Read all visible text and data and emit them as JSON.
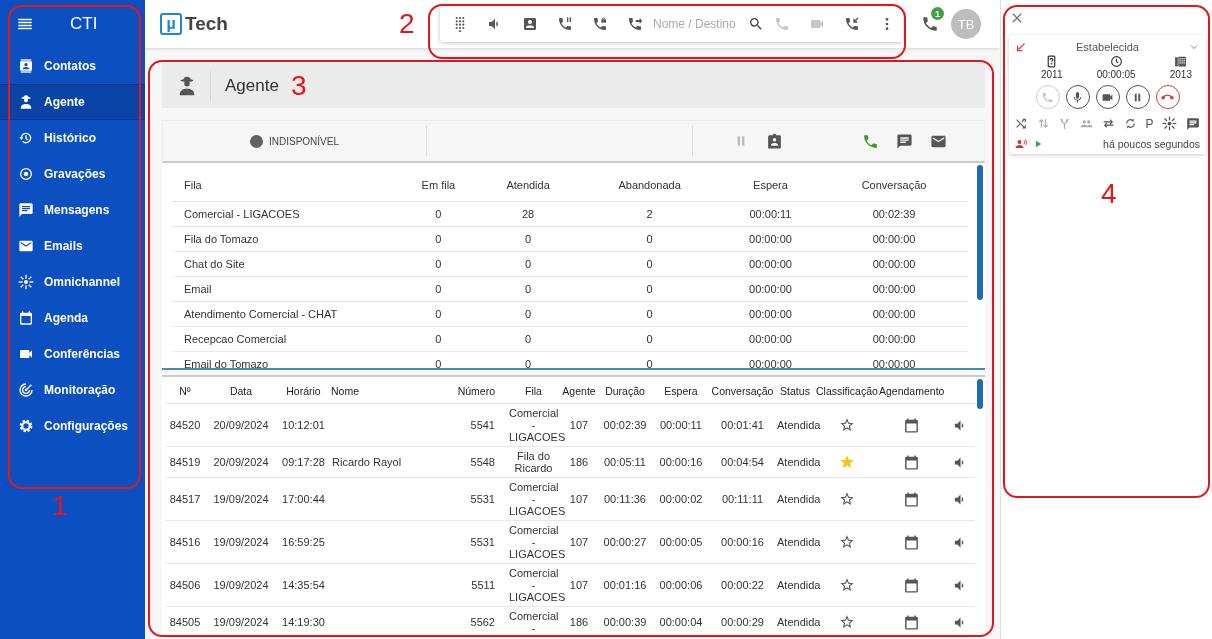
{
  "sidebar": {
    "title": "CTI",
    "items": [
      {
        "label": "Contatos",
        "selected": false
      },
      {
        "label": "Agente",
        "selected": true
      },
      {
        "label": "Histórico",
        "selected": false
      },
      {
        "label": "Gravações",
        "selected": false
      },
      {
        "label": "Mensagens",
        "selected": false
      },
      {
        "label": "Emails",
        "selected": false
      },
      {
        "label": "Omnichannel",
        "selected": false
      },
      {
        "label": "Agenda",
        "selected": false
      },
      {
        "label": "Conferências",
        "selected": false
      },
      {
        "label": "Monitoração",
        "selected": false
      },
      {
        "label": "Configurações",
        "selected": false
      }
    ]
  },
  "header": {
    "logo_mark": "µ",
    "logo_text": "Tech",
    "search": {
      "placeholder": "Nome / Destino"
    },
    "call_buttons": [
      {
        "disabled": true
      },
      {
        "disabled": true
      },
      {
        "disabled": false
      }
    ],
    "notification_badge": "1",
    "avatar": "TB"
  },
  "page": {
    "title": "Agente",
    "status": {
      "label": "INDISPONÍVEL",
      "pause_disabled": true
    }
  },
  "queue_table": {
    "columns": [
      "Fila",
      "Em fila",
      "Atendida",
      "Abandonada",
      "Espera",
      "Conversação"
    ],
    "rows": [
      [
        "Comercial - LIGACOES",
        "0",
        "28",
        "2",
        "00:00:11",
        "00:02:39"
      ],
      [
        "Fila do Tomazo",
        "0",
        "0",
        "0",
        "00:00:00",
        "00:00:00"
      ],
      [
        "Chat do Site",
        "0",
        "0",
        "0",
        "00:00:00",
        "00:00:00"
      ],
      [
        "Email",
        "0",
        "0",
        "0",
        "00:00:00",
        "00:00:00"
      ],
      [
        "Atendimento Comercial - CHAT",
        "0",
        "0",
        "0",
        "00:00:00",
        "00:00:00"
      ],
      [
        "Recepcao Comercial",
        "0",
        "0",
        "0",
        "00:00:00",
        "00:00:00"
      ],
      [
        "Email do Tomazo",
        "0",
        "0",
        "0",
        "00:00:00",
        "00:00:00"
      ]
    ]
  },
  "calls_table": {
    "columns": [
      "Nº",
      "Data",
      "Horário",
      "Nome",
      "Número",
      "Fila",
      "Agente",
      "Duração",
      "Espera",
      "Conversação",
      "Status",
      "Classificação",
      "Agendamento"
    ],
    "rows": [
      {
        "number": "84520",
        "date": "20/09/2024",
        "time": "10:12:01",
        "phone": "5541",
        "queue": "Comercial - LIGACOES",
        "agent": "107",
        "duration": "00:02:39",
        "wait": "00:00:11",
        "talk": "00:01:41",
        "status": "Atendida",
        "starred": false
      },
      {
        "number": "84519",
        "date": "20/09/2024",
        "time": "09:17:28",
        "name": "Ricardo Rayol",
        "phone": "5548",
        "queue": "Fila do Ricardo",
        "agent": "186",
        "duration": "00:05:11",
        "wait": "00:00:16",
        "talk": "00:04:54",
        "status": "Atendida",
        "starred": true
      },
      {
        "number": "84517",
        "date": "19/09/2024",
        "time": "17:00:44",
        "phone": "5531",
        "queue": "Comercial - LIGACOES",
        "agent": "107",
        "duration": "00:11:36",
        "wait": "00:00:02",
        "talk": "00:11:11",
        "status": "Atendida",
        "starred": false
      },
      {
        "number": "84516",
        "date": "19/09/2024",
        "time": "16:59:25",
        "phone": "5531",
        "queue": "Comercial - LIGACOES",
        "agent": "107",
        "duration": "00:00:27",
        "wait": "00:00:05",
        "talk": "00:00:16",
        "status": "Atendida",
        "starred": false
      },
      {
        "number": "84506",
        "date": "19/09/2024",
        "time": "14:35:54",
        "phone": "5511",
        "queue": "Comercial - LIGACOES",
        "agent": "107",
        "duration": "00:01:16",
        "wait": "00:00:06",
        "talk": "00:00:22",
        "status": "Atendida",
        "starred": false
      },
      {
        "number": "84505",
        "date": "19/09/2024",
        "time": "14:19:30",
        "phone": "5562",
        "queue": "Comercial -",
        "agent": "186",
        "duration": "00:00:39",
        "wait": "00:00:04",
        "talk": "00:00:29",
        "status": "Atendida",
        "starred": false
      }
    ]
  },
  "call_panel": {
    "status": "Estabelecida",
    "caller": "2011",
    "duration": "00:00:05",
    "callee": "2013",
    "controls": [
      {
        "disabled": true
      },
      {
        "disabled": false
      },
      {
        "disabled": false
      },
      {
        "disabled": false
      },
      {
        "disabled": false
      }
    ],
    "park_label": "P",
    "time_ago": "há poucos segundos"
  },
  "annotations": [
    {
      "label": "1"
    },
    {
      "label": "2"
    },
    {
      "label": "3"
    },
    {
      "label": "4"
    }
  ]
}
